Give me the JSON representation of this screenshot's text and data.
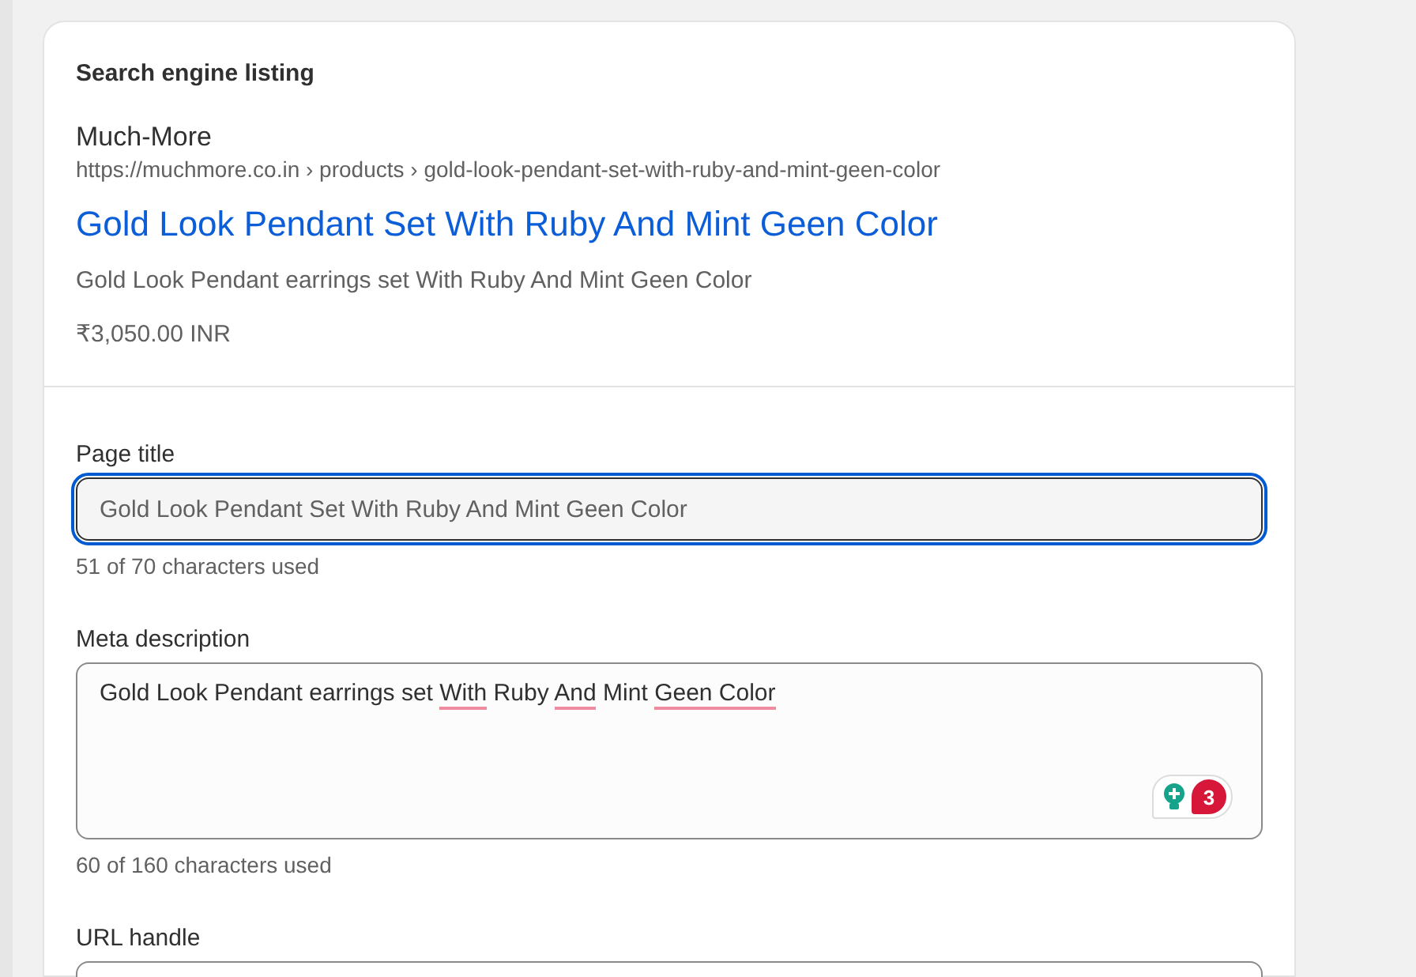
{
  "listing": {
    "heading": "Search engine listing",
    "site_name": "Much-More",
    "breadcrumb": "https://muchmore.co.in › products › gold-look-pendant-set-with-ruby-and-mint-geen-color",
    "title": "Gold Look Pendant Set With Ruby And Mint Geen Color",
    "description": "Gold Look Pendant earrings set With Ruby And Mint Geen Color",
    "price": "₹3,050.00 INR"
  },
  "fields": [
    {
      "kind": "input",
      "label": "Page title",
      "value": "Gold Look Pendant Set With Ruby And Mint Geen Color",
      "focused": true,
      "help": "51 of 70 characters used"
    },
    {
      "kind": "textarea",
      "label": "Meta description",
      "segments": [
        {
          "text": "Gold Look Pendant earrings set ",
          "flagged": false
        },
        {
          "text": "With",
          "flagged": true
        },
        {
          "text": " Ruby ",
          "flagged": false
        },
        {
          "text": "And",
          "flagged": true
        },
        {
          "text": " Mint ",
          "flagged": false
        },
        {
          "text": "Geen Color",
          "flagged": true
        }
      ],
      "focused": false,
      "suggestion_count": "3",
      "help": "60 of 160 characters used"
    },
    {
      "kind": "input",
      "label": "URL handle",
      "focused": false
    }
  ]
}
